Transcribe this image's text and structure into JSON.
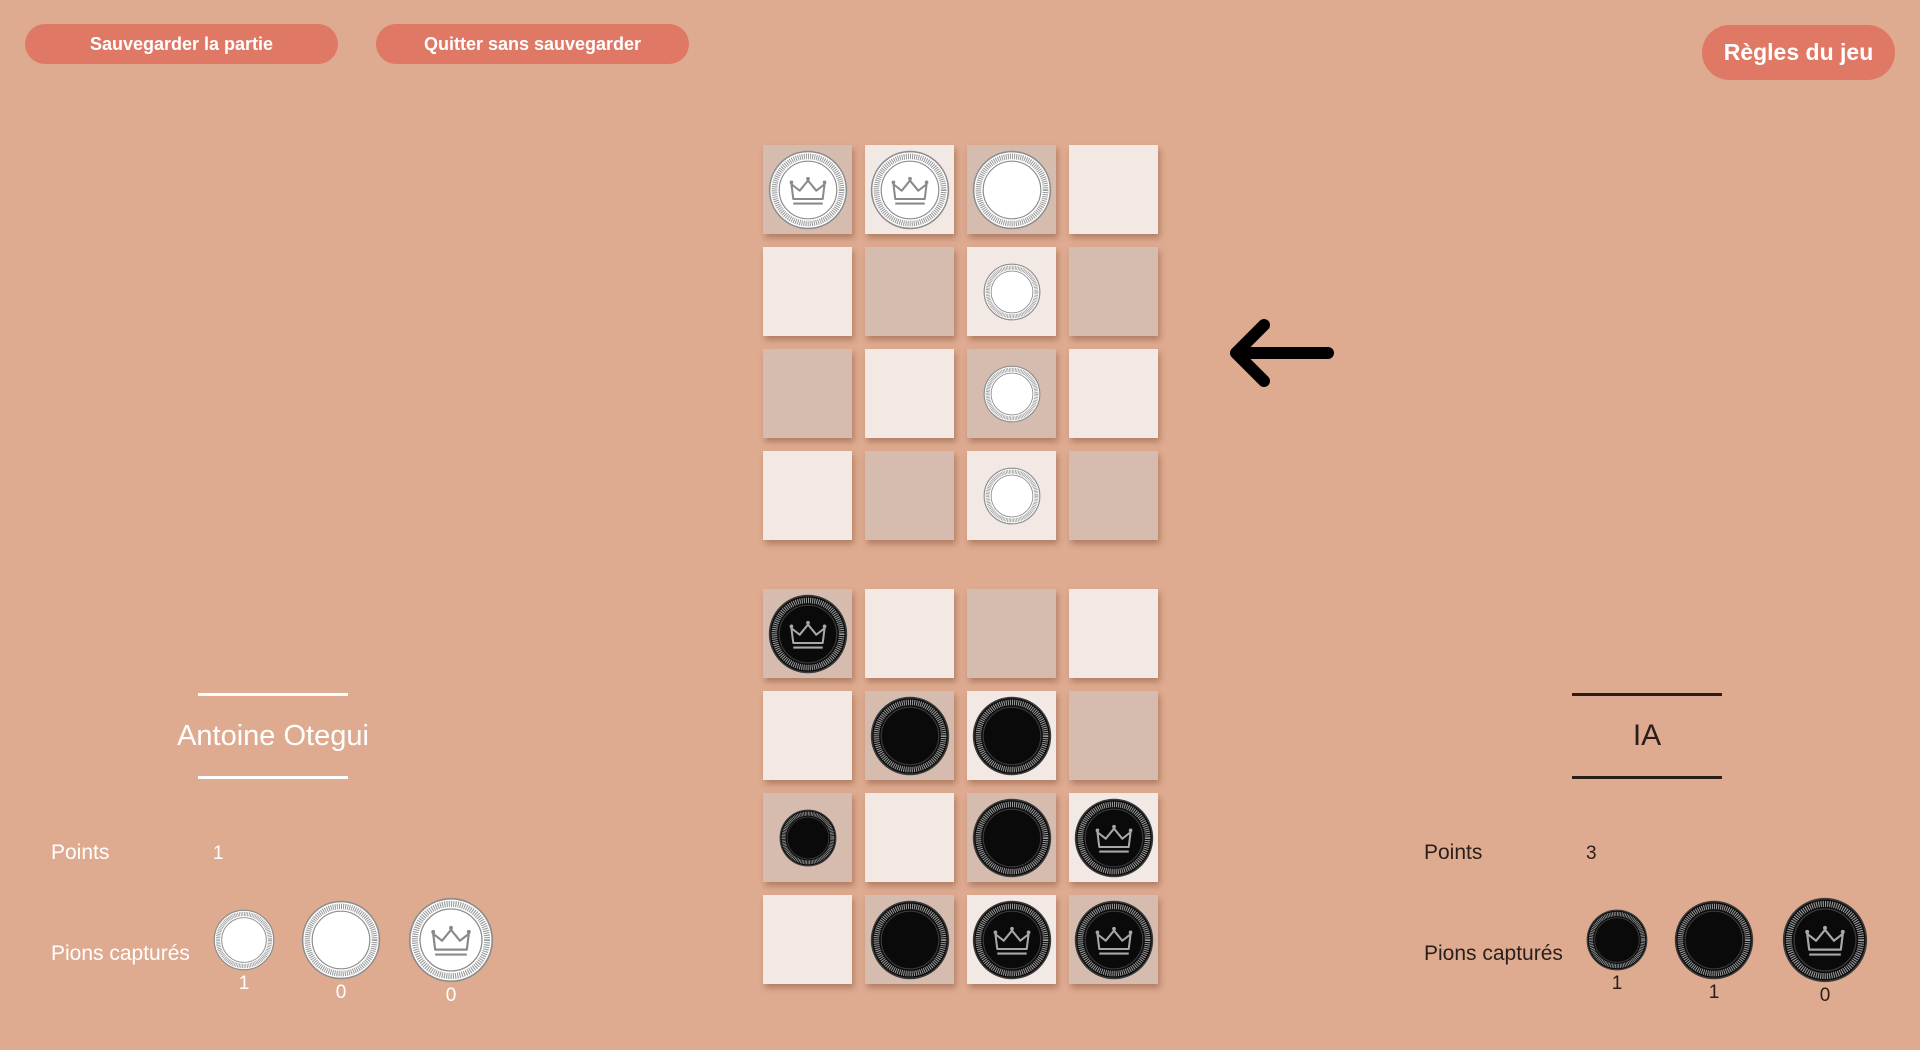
{
  "toolbar": {
    "save_label": "Sauvegarder la partie",
    "quit_label": "Quitter sans sauvegarder",
    "rules_label": "Règles du jeu"
  },
  "turn_indicator": {
    "icon": "arrow-left-icon",
    "direction": "left"
  },
  "colors": {
    "background": "#dfab90",
    "button": "#e07866",
    "cell_light": "#f2e8e4",
    "cell_dark": "#d6bcaf"
  },
  "board_top": {
    "cells": [
      [
        "dark",
        "light",
        "dark",
        "light"
      ],
      [
        "light",
        "dark",
        "light",
        "dark"
      ],
      [
        "dark",
        "light",
        "dark",
        "light"
      ],
      [
        "light",
        "dark",
        "light",
        "dark"
      ]
    ],
    "pieces": [
      [
        "white-crown-large",
        "white-crown-large",
        "white-plain-large",
        null
      ],
      [
        null,
        null,
        "white-plain-small",
        null
      ],
      [
        null,
        null,
        "white-plain-small",
        null
      ],
      [
        null,
        null,
        "white-plain-small",
        null
      ]
    ]
  },
  "board_bottom": {
    "cells": [
      [
        "dark",
        "light",
        "dark",
        "light"
      ],
      [
        "light",
        "dark",
        "light",
        "dark"
      ],
      [
        "dark",
        "light",
        "dark",
        "light"
      ],
      [
        "light",
        "dark",
        "light",
        "dark"
      ]
    ],
    "pieces": [
      [
        "black-crown-large",
        null,
        null,
        null
      ],
      [
        null,
        "black-plain-large",
        "black-plain-large",
        null
      ],
      [
        "black-plain-small",
        null,
        "black-plain-large",
        "black-crown-large"
      ],
      [
        null,
        "black-plain-large",
        "black-crown-large",
        "black-crown-large"
      ]
    ]
  },
  "player1": {
    "name": "Antoine Otegui",
    "points_label": "Points",
    "points": "1",
    "captured_label": "Pions capturés",
    "captured": [
      {
        "piece": "white-plain-small",
        "count": "1"
      },
      {
        "piece": "white-plain-large",
        "count": "0"
      },
      {
        "piece": "white-crown-large",
        "count": "0"
      }
    ]
  },
  "player2": {
    "name": "IA",
    "points_label": "Points",
    "points": "3",
    "captured_label": "Pions capturés",
    "captured": [
      {
        "piece": "black-plain-small",
        "count": "1"
      },
      {
        "piece": "black-plain-large",
        "count": "1"
      },
      {
        "piece": "black-crown-large",
        "count": "0"
      }
    ]
  }
}
